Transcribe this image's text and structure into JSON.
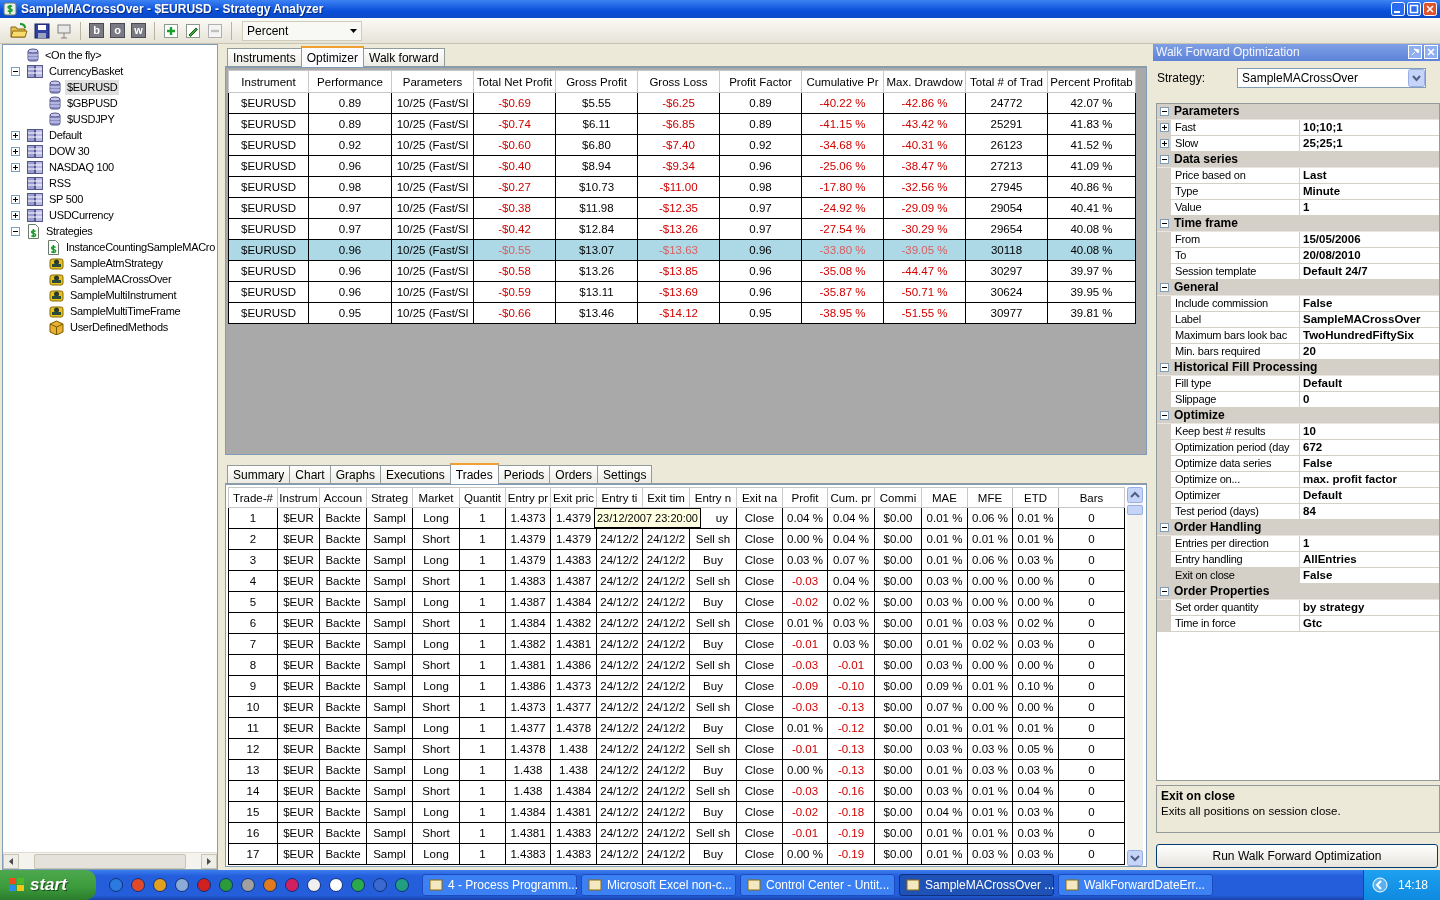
{
  "window": {
    "title": "SampleMACrossOver - $EURUSD - Strategy Analyzer"
  },
  "toolbar": {
    "letter_buttons": [
      "b",
      "o",
      "w"
    ],
    "remove_disabled": true,
    "display_unit": "Percent"
  },
  "tree": [
    {
      "label": "<On the fly>",
      "kind": "database",
      "expandable": false,
      "selected": false
    },
    {
      "label": "CurrencyBasket",
      "kind": "list",
      "expandable": true,
      "expanded": true,
      "selected": false,
      "children": [
        {
          "label": "$EURUSD",
          "kind": "database",
          "selected": true
        },
        {
          "label": "$GBPUSD",
          "kind": "database",
          "selected": false
        },
        {
          "label": "$USDJPY",
          "kind": "database",
          "selected": false
        }
      ]
    },
    {
      "label": "Default",
      "kind": "list",
      "expandable": true,
      "expanded": false,
      "selected": false
    },
    {
      "label": "DOW 30",
      "kind": "list",
      "expandable": true,
      "expanded": false,
      "selected": false
    },
    {
      "label": "NASDAQ 100",
      "kind": "list",
      "expandable": true,
      "expanded": false,
      "selected": false
    },
    {
      "label": "RSS",
      "kind": "list",
      "expandable": false,
      "selected": false
    },
    {
      "label": "SP 500",
      "kind": "list",
      "expandable": true,
      "expanded": false,
      "selected": false
    },
    {
      "label": "USDCurrency",
      "kind": "list",
      "expandable": true,
      "expanded": false,
      "selected": false
    },
    {
      "label": "Strategies",
      "kind": "dollar",
      "expandable": true,
      "expanded": true,
      "selected": false,
      "children": [
        {
          "label": "InstanceCountingSampleMACro",
          "kind": "dollar",
          "selected": false
        },
        {
          "label": "SampleAtmStrategy",
          "kind": "scroll",
          "selected": false
        },
        {
          "label": "SampleMACrossOver",
          "kind": "scroll",
          "selected": false
        },
        {
          "label": "SampleMultiInstrument",
          "kind": "scroll",
          "selected": false
        },
        {
          "label": "SampleMultiTimeFrame",
          "kind": "scroll",
          "selected": false
        },
        {
          "label": "UserDefinedMethods",
          "kind": "box",
          "selected": false
        }
      ]
    }
  ],
  "top_tabs": [
    {
      "label": "Instruments",
      "selected": false
    },
    {
      "label": "Optimizer",
      "selected": true
    },
    {
      "label": "Walk forward",
      "selected": false
    }
  ],
  "optimizer_table": {
    "columns": [
      {
        "label": "Instrument",
        "kind": "plain"
      },
      {
        "label": "Performance",
        "kind": "plain"
      },
      {
        "label": "Parameters",
        "kind": "plain"
      },
      {
        "label": "Total Net Profit",
        "kind": "loss"
      },
      {
        "label": "Gross Profit",
        "kind": "plain"
      },
      {
        "label": "Gross Loss",
        "kind": "loss"
      },
      {
        "label": "Profit Factor",
        "kind": "plain"
      },
      {
        "label": "Cumulative Pr",
        "kind": "loss"
      },
      {
        "label": "Max. Drawdow",
        "kind": "loss"
      },
      {
        "label": "Total # of Trad",
        "kind": "plain"
      },
      {
        "label": "Percent Profitab",
        "kind": "plain"
      }
    ],
    "rows": [
      {
        "selected": false,
        "cells": [
          "$EURUSD",
          "0.89",
          "10/25 (Fast/Sl",
          "-$0.69",
          "$5.55",
          "-$6.25",
          "0.89",
          "-40.22 %",
          "-42.86 %",
          "24772",
          "42.07 %"
        ]
      },
      {
        "selected": false,
        "cells": [
          "$EURUSD",
          "0.89",
          "10/25 (Fast/Sl",
          "-$0.74",
          "$6.11",
          "-$6.85",
          "0.89",
          "-41.15 %",
          "-43.42 %",
          "25291",
          "41.83 %"
        ]
      },
      {
        "selected": false,
        "cells": [
          "$EURUSD",
          "0.92",
          "10/25 (Fast/Sl",
          "-$0.60",
          "$6.80",
          "-$7.40",
          "0.92",
          "-34.68 %",
          "-40.31 %",
          "26123",
          "41.52 %"
        ]
      },
      {
        "selected": false,
        "cells": [
          "$EURUSD",
          "0.96",
          "10/25 (Fast/Sl",
          "-$0.40",
          "$8.94",
          "-$9.34",
          "0.96",
          "-25.06 %",
          "-38.47 %",
          "27213",
          "41.09 %"
        ]
      },
      {
        "selected": false,
        "cells": [
          "$EURUSD",
          "0.98",
          "10/25 (Fast/Sl",
          "-$0.27",
          "$10.73",
          "-$11.00",
          "0.98",
          "-17.80 %",
          "-32.56 %",
          "27945",
          "40.86 %"
        ]
      },
      {
        "selected": false,
        "cells": [
          "$EURUSD",
          "0.97",
          "10/25 (Fast/Sl",
          "-$0.38",
          "$11.98",
          "-$12.35",
          "0.97",
          "-24.92 %",
          "-29.09 %",
          "29054",
          "40.41 %"
        ]
      },
      {
        "selected": false,
        "cells": [
          "$EURUSD",
          "0.97",
          "10/25 (Fast/Sl",
          "-$0.42",
          "$12.84",
          "-$13.26",
          "0.97",
          "-27.54 %",
          "-30.29 %",
          "29654",
          "40.08 %"
        ]
      },
      {
        "selected": true,
        "cells": [
          "$EURUSD",
          "0.96",
          "10/25 (Fast/Sl",
          "-$0.55",
          "$13.07",
          "-$13.63",
          "0.96",
          "-33.80 %",
          "-39.05 %",
          "30118",
          "40.08 %"
        ]
      },
      {
        "selected": false,
        "cells": [
          "$EURUSD",
          "0.96",
          "10/25 (Fast/Sl",
          "-$0.58",
          "$13.26",
          "-$13.85",
          "0.96",
          "-35.08 %",
          "-44.47 %",
          "30297",
          "39.97 %"
        ]
      },
      {
        "selected": false,
        "cells": [
          "$EURUSD",
          "0.96",
          "10/25 (Fast/Sl",
          "-$0.59",
          "$13.11",
          "-$13.69",
          "0.96",
          "-35.87 %",
          "-50.71 %",
          "30624",
          "39.95 %"
        ]
      },
      {
        "selected": false,
        "cells": [
          "$EURUSD",
          "0.95",
          "10/25 (Fast/Sl",
          "-$0.66",
          "$13.46",
          "-$14.12",
          "0.95",
          "-38.95 %",
          "-51.55 %",
          "30977",
          "39.81 %"
        ]
      }
    ]
  },
  "bottom_tabs": [
    {
      "label": "Summary",
      "selected": false
    },
    {
      "label": "Chart",
      "selected": false
    },
    {
      "label": "Graphs",
      "selected": false
    },
    {
      "label": "Executions",
      "selected": false
    },
    {
      "label": "Trades",
      "selected": true
    },
    {
      "label": "Periods",
      "selected": false
    },
    {
      "label": "Orders",
      "selected": false
    },
    {
      "label": "Settings",
      "selected": false
    }
  ],
  "trades_table": {
    "columns": [
      {
        "label": "Trade-#",
        "kind": "plain"
      },
      {
        "label": "Instrum",
        "kind": "plain"
      },
      {
        "label": "Accoun",
        "kind": "plain"
      },
      {
        "label": "Strateg",
        "kind": "plain"
      },
      {
        "label": "Market",
        "kind": "plain"
      },
      {
        "label": "Quantit",
        "kind": "plain"
      },
      {
        "label": "Entry pr",
        "kind": "plain"
      },
      {
        "label": "Exit pric",
        "kind": "plain"
      },
      {
        "label": "Entry ti",
        "kind": "plain"
      },
      {
        "label": "Exit tim",
        "kind": "plain"
      },
      {
        "label": "Entry n",
        "kind": "plain"
      },
      {
        "label": "Exit na",
        "kind": "plain"
      },
      {
        "label": "Profit",
        "kind": "profit"
      },
      {
        "label": "Cum. pr",
        "kind": "cum"
      },
      {
        "label": "Commi",
        "kind": "plain"
      },
      {
        "label": "MAE",
        "kind": "plain"
      },
      {
        "label": "MFE",
        "kind": "plain"
      },
      {
        "label": "ETD",
        "kind": "plain"
      },
      {
        "label": "Bars",
        "kind": "plain"
      }
    ],
    "tooltip": {
      "text": "23/12/2007 23:20:00"
    },
    "rows": [
      {
        "profit_loss": false,
        "cum_loss": false,
        "cells": [
          "1",
          "$EUR",
          "Backte",
          "Sampl",
          "Long",
          "1",
          "1.4373",
          "1.4379",
          null,
          null,
          "uy",
          "Close",
          "0.04 %",
          "0.04 %",
          "$0.00",
          "0.01 %",
          "0.06 %",
          "0.01 %",
          "0"
        ]
      },
      {
        "profit_loss": false,
        "cum_loss": false,
        "cells": [
          "2",
          "$EUR",
          "Backte",
          "Sampl",
          "Short",
          "1",
          "1.4379",
          "1.4379",
          "24/12/2",
          "24/12/2",
          "Sell sh",
          "Close",
          "0.00 %",
          "0.04 %",
          "$0.00",
          "0.01 %",
          "0.01 %",
          "0.01 %",
          "0"
        ]
      },
      {
        "profit_loss": false,
        "cum_loss": false,
        "cells": [
          "3",
          "$EUR",
          "Backte",
          "Sampl",
          "Long",
          "1",
          "1.4379",
          "1.4383",
          "24/12/2",
          "24/12/2",
          "Buy",
          "Close",
          "0.03 %",
          "0.07 %",
          "$0.00",
          "0.01 %",
          "0.06 %",
          "0.03 %",
          "0"
        ]
      },
      {
        "profit_loss": true,
        "cum_loss": false,
        "cells": [
          "4",
          "$EUR",
          "Backte",
          "Sampl",
          "Short",
          "1",
          "1.4383",
          "1.4387",
          "24/12/2",
          "24/12/2",
          "Sell sh",
          "Close",
          "-0.03",
          "0.04 %",
          "$0.00",
          "0.03 %",
          "0.00 %",
          "0.00 %",
          "0"
        ]
      },
      {
        "profit_loss": true,
        "cum_loss": false,
        "cells": [
          "5",
          "$EUR",
          "Backte",
          "Sampl",
          "Long",
          "1",
          "1.4387",
          "1.4384",
          "24/12/2",
          "24/12/2",
          "Buy",
          "Close",
          "-0.02",
          "0.02 %",
          "$0.00",
          "0.03 %",
          "0.00 %",
          "0.00 %",
          "0"
        ]
      },
      {
        "profit_loss": false,
        "cum_loss": false,
        "cells": [
          "6",
          "$EUR",
          "Backte",
          "Sampl",
          "Short",
          "1",
          "1.4384",
          "1.4382",
          "24/12/2",
          "24/12/2",
          "Sell sh",
          "Close",
          "0.01 %",
          "0.03 %",
          "$0.00",
          "0.01 %",
          "0.03 %",
          "0.02 %",
          "0"
        ]
      },
      {
        "profit_loss": true,
        "cum_loss": false,
        "cells": [
          "7",
          "$EUR",
          "Backte",
          "Sampl",
          "Long",
          "1",
          "1.4382",
          "1.4381",
          "24/12/2",
          "24/12/2",
          "Buy",
          "Close",
          "-0.01",
          "0.03 %",
          "$0.00",
          "0.01 %",
          "0.02 %",
          "0.03 %",
          "0"
        ]
      },
      {
        "profit_loss": true,
        "cum_loss": true,
        "cells": [
          "8",
          "$EUR",
          "Backte",
          "Sampl",
          "Short",
          "1",
          "1.4381",
          "1.4386",
          "24/12/2",
          "24/12/2",
          "Sell sh",
          "Close",
          "-0.03",
          "-0.01",
          "$0.00",
          "0.03 %",
          "0.00 %",
          "0.00 %",
          "0"
        ]
      },
      {
        "profit_loss": true,
        "cum_loss": true,
        "cells": [
          "9",
          "$EUR",
          "Backte",
          "Sampl",
          "Long",
          "1",
          "1.4386",
          "1.4373",
          "24/12/2",
          "24/12/2",
          "Buy",
          "Close",
          "-0.09",
          "-0.10",
          "$0.00",
          "0.09 %",
          "0.01 %",
          "0.10 %",
          "0"
        ]
      },
      {
        "profit_loss": true,
        "cum_loss": true,
        "cells": [
          "10",
          "$EUR",
          "Backte",
          "Sampl",
          "Short",
          "1",
          "1.4373",
          "1.4377",
          "24/12/2",
          "24/12/2",
          "Sell sh",
          "Close",
          "-0.03",
          "-0.13",
          "$0.00",
          "0.07 %",
          "0.00 %",
          "0.00 %",
          "0"
        ]
      },
      {
        "profit_loss": false,
        "cum_loss": true,
        "cells": [
          "11",
          "$EUR",
          "Backte",
          "Sampl",
          "Long",
          "1",
          "1.4377",
          "1.4378",
          "24/12/2",
          "24/12/2",
          "Buy",
          "Close",
          "0.01 %",
          "-0.12",
          "$0.00",
          "0.01 %",
          "0.01 %",
          "0.01 %",
          "0"
        ]
      },
      {
        "profit_loss": true,
        "cum_loss": true,
        "cells": [
          "12",
          "$EUR",
          "Backte",
          "Sampl",
          "Short",
          "1",
          "1.4378",
          "1.438",
          "24/12/2",
          "24/12/2",
          "Sell sh",
          "Close",
          "-0.01",
          "-0.13",
          "$0.00",
          "0.03 %",
          "0.03 %",
          "0.05 %",
          "0"
        ]
      },
      {
        "profit_loss": false,
        "cum_loss": true,
        "cells": [
          "13",
          "$EUR",
          "Backte",
          "Sampl",
          "Long",
          "1",
          "1.438",
          "1.438",
          "24/12/2",
          "24/12/2",
          "Buy",
          "Close",
          "0.00 %",
          "-0.13",
          "$0.00",
          "0.01 %",
          "0.03 %",
          "0.03 %",
          "0"
        ]
      },
      {
        "profit_loss": true,
        "cum_loss": true,
        "cells": [
          "14",
          "$EUR",
          "Backte",
          "Sampl",
          "Short",
          "1",
          "1.438",
          "1.4384",
          "24/12/2",
          "24/12/2",
          "Sell sh",
          "Close",
          "-0.03",
          "-0.16",
          "$0.00",
          "0.03 %",
          "0.01 %",
          "0.04 %",
          "0"
        ]
      },
      {
        "profit_loss": true,
        "cum_loss": true,
        "cells": [
          "15",
          "$EUR",
          "Backte",
          "Sampl",
          "Long",
          "1",
          "1.4384",
          "1.4381",
          "24/12/2",
          "24/12/2",
          "Buy",
          "Close",
          "-0.02",
          "-0.18",
          "$0.00",
          "0.04 %",
          "0.01 %",
          "0.03 %",
          "0"
        ]
      },
      {
        "profit_loss": true,
        "cum_loss": true,
        "cells": [
          "16",
          "$EUR",
          "Backte",
          "Sampl",
          "Short",
          "1",
          "1.4381",
          "1.4383",
          "24/12/2",
          "24/12/2",
          "Sell sh",
          "Close",
          "-0.01",
          "-0.19",
          "$0.00",
          "0.01 %",
          "0.01 %",
          "0.03 %",
          "0"
        ]
      },
      {
        "profit_loss": false,
        "cum_loss": true,
        "cells": [
          "17",
          "$EUR",
          "Backte",
          "Sampl",
          "Long",
          "1",
          "1.4383",
          "1.4383",
          "24/12/2",
          "24/12/2",
          "Buy",
          "Close",
          "0.00 %",
          "-0.19",
          "$0.00",
          "0.01 %",
          "0.03 %",
          "0.03 %",
          "0"
        ]
      }
    ]
  },
  "walk_forward": {
    "title": "Walk Forward Optimization",
    "strategy_label": "Strategy:",
    "strategy": "SampleMACrossOver",
    "categories": [
      {
        "name": "Parameters",
        "expanded": true,
        "rows": [
          {
            "label": "Fast",
            "value": "10;10;1",
            "kind": "nested",
            "selected": false
          },
          {
            "label": "Slow",
            "value": "25;25;1",
            "kind": "nested",
            "selected": false
          }
        ]
      },
      {
        "name": "Data series",
        "expanded": true,
        "rows": [
          {
            "label": "Price based on",
            "value": "Last",
            "kind": "plain",
            "selected": false
          },
          {
            "label": "Type",
            "value": "Minute",
            "kind": "plain",
            "selected": false
          },
          {
            "label": "Value",
            "value": "1",
            "kind": "plain",
            "selected": false
          }
        ]
      },
      {
        "name": "Time frame",
        "expanded": true,
        "rows": [
          {
            "label": "From",
            "value": "15/05/2006",
            "kind": "plain",
            "selected": false
          },
          {
            "label": "To",
            "value": "20/08/2010",
            "kind": "plain",
            "selected": false
          },
          {
            "label": "Session template",
            "value": "Default 24/7",
            "kind": "plain",
            "selected": false
          }
        ]
      },
      {
        "name": "General",
        "expanded": true,
        "rows": [
          {
            "label": "Include commission",
            "value": "False",
            "kind": "plain",
            "selected": false
          },
          {
            "label": "Label",
            "value": "SampleMACrossOver",
            "kind": "plain",
            "selected": false
          },
          {
            "label": "Maximum bars look bac",
            "value": "TwoHundredFiftySix",
            "kind": "plain",
            "selected": false
          },
          {
            "label": "Min. bars required",
            "value": "20",
            "kind": "plain",
            "selected": false
          }
        ]
      },
      {
        "name": "Historical Fill Processing",
        "expanded": true,
        "rows": [
          {
            "label": "Fill type",
            "value": "Default",
            "kind": "plain",
            "selected": false
          },
          {
            "label": "Slippage",
            "value": "0",
            "kind": "plain",
            "selected": false
          }
        ]
      },
      {
        "name": "Optimize",
        "expanded": true,
        "rows": [
          {
            "label": "Keep best # results",
            "value": "10",
            "kind": "plain",
            "selected": false
          },
          {
            "label": "Optimization period (day",
            "value": "672",
            "kind": "plain",
            "selected": false
          },
          {
            "label": "Optimize data series",
            "value": "False",
            "kind": "plain",
            "selected": false
          },
          {
            "label": "Optimize on...",
            "value": "max. profit factor",
            "kind": "plain",
            "selected": false
          },
          {
            "label": "Optimizer",
            "value": "Default",
            "kind": "plain",
            "selected": false
          },
          {
            "label": "Test period (days)",
            "value": "84",
            "kind": "plain",
            "selected": false
          }
        ]
      },
      {
        "name": "Order Handling",
        "expanded": true,
        "rows": [
          {
            "label": "Entries per direction",
            "value": "1",
            "kind": "plain",
            "selected": false
          },
          {
            "label": "Entry handling",
            "value": "AllEntries",
            "kind": "plain",
            "selected": false
          },
          {
            "label": "Exit on close",
            "value": "False",
            "kind": "plain",
            "selected": true
          }
        ]
      },
      {
        "name": "Order Properties",
        "expanded": true,
        "rows": [
          {
            "label": "Set order quantity",
            "value": "by strategy",
            "kind": "plain",
            "selected": false
          },
          {
            "label": "Time in force",
            "value": "Gtc",
            "kind": "plain",
            "selected": false
          }
        ]
      }
    ],
    "description": {
      "title": "Exit on close",
      "text": "Exits all positions on session close."
    },
    "run_button": "Run Walk Forward Optimization"
  },
  "taskbar": {
    "start": "start",
    "tasks": [
      {
        "label": "4 - Process Programm...",
        "selected": false
      },
      {
        "label": "Microsoft Excel non-c...",
        "selected": false
      },
      {
        "label": "Control Center - Untit...",
        "selected": false
      },
      {
        "label": "SampleMACrossOver ...",
        "selected": true
      },
      {
        "label": "WalkForwardDateErr...",
        "selected": false
      }
    ],
    "clock": "14:18"
  }
}
